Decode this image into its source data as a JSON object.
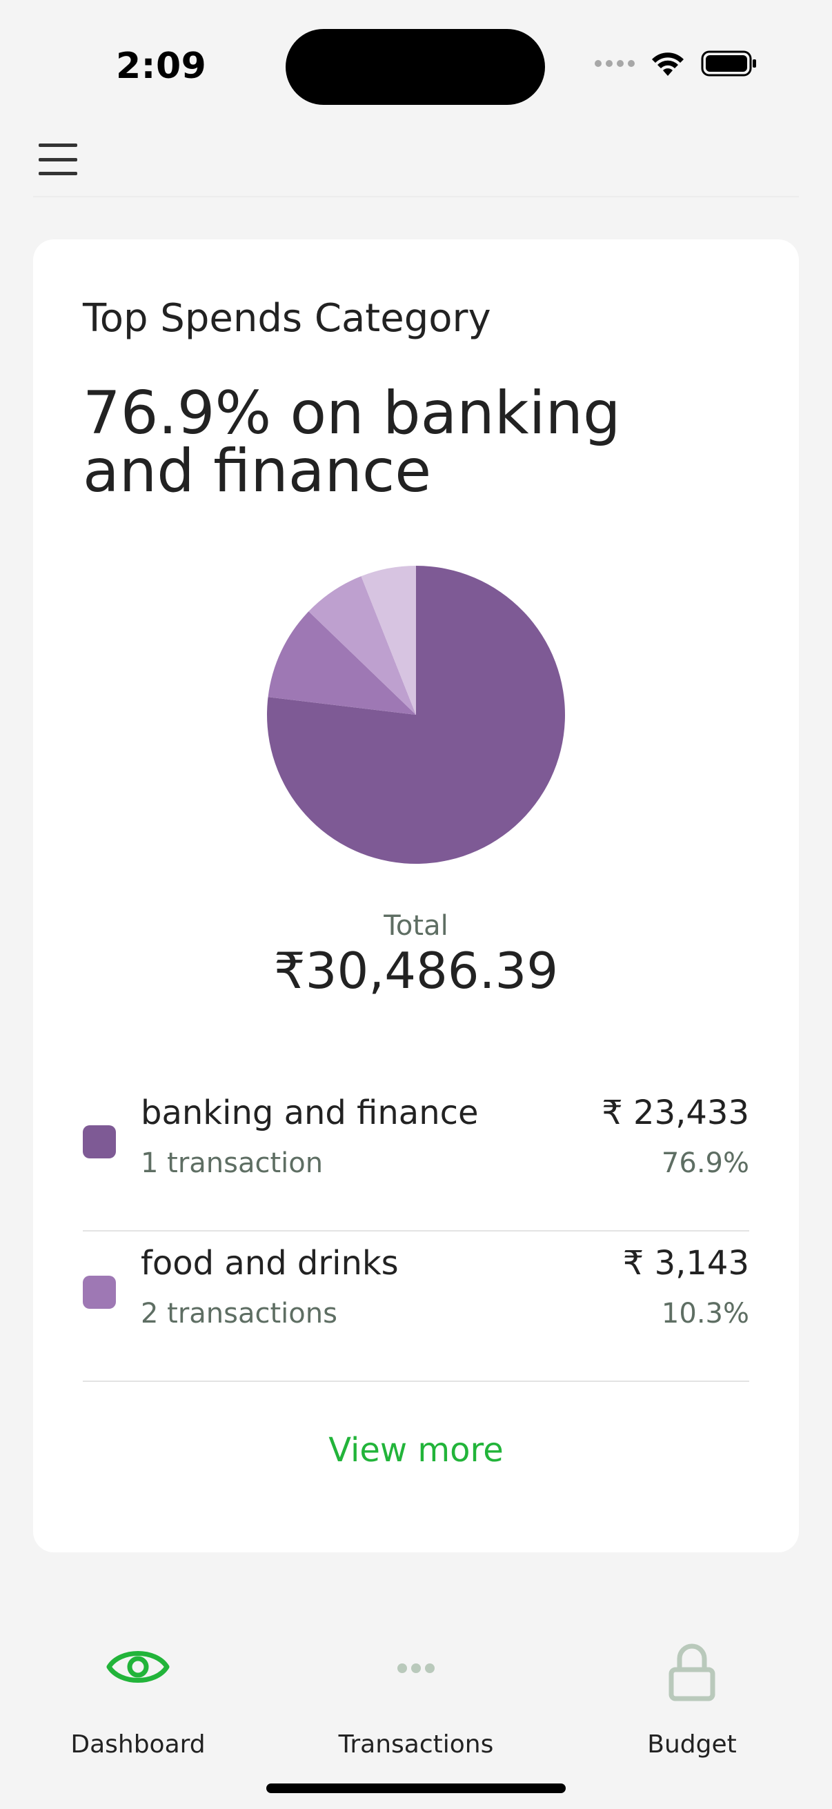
{
  "status_bar": {
    "time": "2:09"
  },
  "header": {
    "menu_icon": "hamburger-menu-icon"
  },
  "card": {
    "title": "Top Spends Category",
    "headline": "76.9% on banking and finance",
    "total_label": "Total",
    "total_value": "₹30,486.39",
    "view_more": "View more"
  },
  "categories": [
    {
      "name": "banking and finance",
      "count": "1 transaction",
      "amount": "₹ 23,433",
      "percent": "76.9%",
      "color": "#7e5a95"
    },
    {
      "name": "food and drinks",
      "count": "2 transactions",
      "amount": "₹ 3,143",
      "percent": "10.3%",
      "color": "#9e78b4"
    }
  ],
  "chart_data": {
    "type": "pie",
    "slices": [
      {
        "label": "banking and finance",
        "value": 76.9,
        "color": "#7e5a95"
      },
      {
        "label": "food and drinks",
        "value": 10.3,
        "color": "#9e78b4"
      },
      {
        "label": "",
        "value": 6.8,
        "color": "#bea0cf"
      },
      {
        "label": "",
        "value": 6.0,
        "color": "#d7c4e1"
      }
    ]
  },
  "bottom_nav": [
    {
      "label": "Dashboard",
      "icon": "eye-icon",
      "active": true
    },
    {
      "label": "Transactions",
      "icon": "more-dots-icon",
      "active": false
    },
    {
      "label": "Budget",
      "icon": "lock-icon",
      "active": false
    }
  ],
  "colors": {
    "accent": "#22b43a",
    "muted_text": "#5e6e63",
    "inactive_icon": "#b9c9bb",
    "background": "#f4f4f4"
  }
}
